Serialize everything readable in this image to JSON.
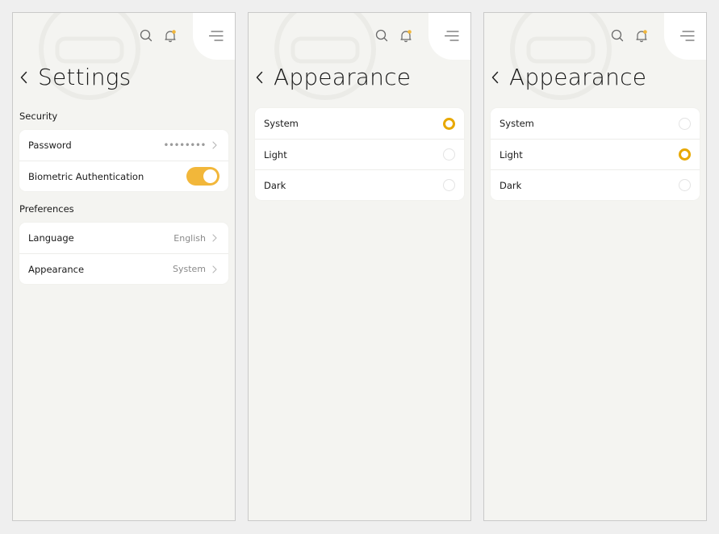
{
  "colors": {
    "accent": "#f2b73a",
    "radio_on": "#e8a800",
    "background": "#f4f4f1"
  },
  "icons": {
    "search": "search-icon",
    "bell": "bell-icon",
    "menu": "menu-icon",
    "back": "chevron-left-icon",
    "chevron": "chevron-right-icon"
  },
  "settings": {
    "title": "Settings",
    "security": {
      "label": "Security",
      "password_label": "Password",
      "password_value": "••••••••",
      "biometric_label": "Biometric Authentication",
      "biometric_enabled": true
    },
    "preferences": {
      "label": "Preferences",
      "language_label": "Language",
      "language_value": "English",
      "appearance_label": "Appearance",
      "appearance_value": "System"
    }
  },
  "appearance_system": {
    "title": "Appearance",
    "options": [
      "System",
      "Light",
      "Dark"
    ],
    "selected": "System"
  },
  "appearance_light": {
    "title": "Appearance",
    "options": [
      "System",
      "Light",
      "Dark"
    ],
    "selected": "Light"
  }
}
